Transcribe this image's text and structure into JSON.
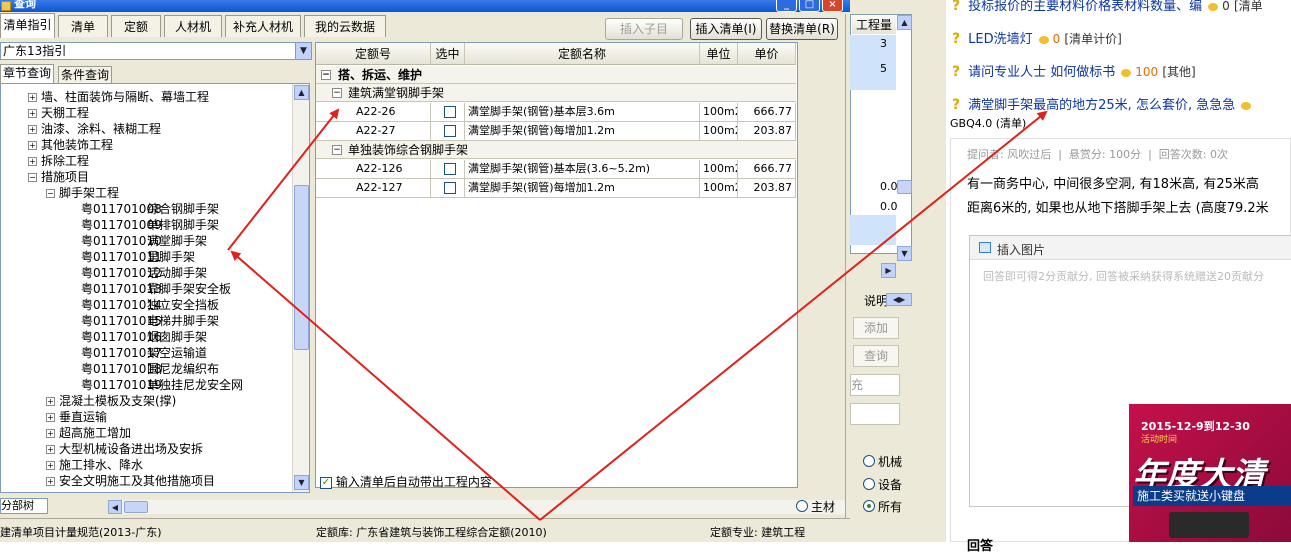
{
  "window": {
    "title": "查询"
  },
  "tabs": [
    "清单指引",
    "清单",
    "定额",
    "人材机",
    "补充人材机",
    "我的云数据"
  ],
  "buttons": {
    "insert_child": "插入子目",
    "insert_list": "插入清单(I)",
    "replace_list": "替换清单(R)"
  },
  "combo": {
    "value": "广东13指引"
  },
  "subtabs": [
    "章节查询",
    "条件查询"
  ],
  "tree": [
    {
      "label": "墙、柱面装饰与隔断、幕墙工程",
      "sign": "+"
    },
    {
      "label": "天棚工程",
      "sign": "+"
    },
    {
      "label": "油漆、涂料、裱糊工程",
      "sign": "+"
    },
    {
      "label": "其他装饰工程",
      "sign": "+"
    },
    {
      "label": "拆除工程",
      "sign": "+"
    },
    {
      "label": "措施项目",
      "sign": "−"
    },
    {
      "label": "脚手架工程",
      "sign": "−"
    }
  ],
  "leaves": [
    {
      "code": "粤011701008",
      "name": "综合钢脚手架"
    },
    {
      "code": "粤011701009",
      "name": "单排钢脚手架"
    },
    {
      "code": "粤011701010",
      "name": "满堂脚手架"
    },
    {
      "code": "粤011701011",
      "name": "里脚手架"
    },
    {
      "code": "粤011701012",
      "name": "活动脚手架"
    },
    {
      "code": "粤011701013",
      "name": "靠脚手架安全板"
    },
    {
      "code": "粤011701014",
      "name": "独立安全挡板"
    },
    {
      "code": "粤011701015",
      "name": "电梯井脚手架"
    },
    {
      "code": "粤011701016",
      "name": "烟囱脚手架"
    },
    {
      "code": "粤011701017",
      "name": "架空运输道"
    },
    {
      "code": "粤011701018",
      "name": "围尼龙编织布"
    },
    {
      "code": "粤011701019",
      "name": "单独挂尼龙安全网"
    }
  ],
  "tree_after": [
    {
      "label": "混凝土模板及支架(撑)",
      "sign": "+"
    },
    {
      "label": "垂直运输",
      "sign": "+"
    },
    {
      "label": "超高施工增加",
      "sign": "+"
    },
    {
      "label": "大型机械设备进出场及安拆",
      "sign": "+"
    },
    {
      "label": "施工排水、降水",
      "sign": "+"
    },
    {
      "label": "安全文明施工及其他措施项目",
      "sign": "+"
    }
  ],
  "bottom_tab": "分部树",
  "grid": {
    "headers": [
      "定额号",
      "选中",
      "定额名称",
      "单位",
      "单价"
    ],
    "group": "搭、拆运、维护",
    "subgroups": [
      {
        "title": "建筑满堂钢脚手架",
        "rows": [
          {
            "code": "A22-26",
            "name": "满堂脚手架(钢管)基本层3.6m",
            "unit": "100m2",
            "price": "666.77"
          },
          {
            "code": "A22-27",
            "name": "满堂脚手架(钢管)每增加1.2m",
            "unit": "100m2",
            "price": "203.87"
          }
        ]
      },
      {
        "title": "单独装饰综合钢脚手架",
        "rows": [
          {
            "code": "A22-126",
            "name": "满堂脚手架(钢管)基本层(3.6~5.2m)",
            "unit": "100m2",
            "price": "666.77"
          },
          {
            "code": "A22-127",
            "name": "满堂脚手架(钢管)每增加1.2m",
            "unit": "100m2",
            "price": "203.87"
          }
        ]
      }
    ]
  },
  "auto_check": "输入清单后自动带出工程内容",
  "status": {
    "left": "建清单项目计量规范(2013-广东)",
    "mid": "定额库: 广东省建筑与装饰工程综合定额(2010)",
    "right": "定额专业: 建筑工程"
  },
  "behind": {
    "col_header": "工程量",
    "val1": "3",
    "val2": "5",
    "val3": "0.0",
    "val4": "0.0",
    "desc_label": "说明",
    "add": "添加",
    "query": "查询",
    "supplement": "充",
    "radios": [
      "机械",
      "设备",
      "主材",
      "所有"
    ]
  },
  "web": {
    "q1": {
      "text": "投标报价的主要材料价格表材料数量、编",
      "coin": "0",
      "cat": "[清单"
    },
    "q2": {
      "text": "LED洗墙灯",
      "coin": "0",
      "cat": "[清单计价]"
    },
    "q3": {
      "text": "请问专业人士 如何做标书",
      "coin": "100",
      "cat": "[其他]"
    },
    "q4": {
      "text": "满堂脚手架最高的地方25米, 怎么套价, 急急急",
      "coin": "",
      "cat": "GBQ4.0 (清单)"
    },
    "meta": "提问者: 风吹过后  |  悬赏分: 100分  |  回答次数: 0次",
    "body1": "有一商务中心, 中间很多空洞, 有18米高, 有25米高",
    "body2": "距离6米的, 如果也从地下搭脚手架上去 (高度79.2米",
    "insert_img": "插入图片",
    "placeholder": "回答即可得2分贡献分, 回答被采纳获得系统赠送20贡献分",
    "ad_date": "2015-12-9到12-30",
    "ad_sub": "活动时间",
    "ad_title": "年度大清",
    "ad_slogan": "施工类买就送小键盘",
    "answer": "回答"
  },
  "colors": {
    "accent": "#0b36a3",
    "arrow": "#e0201a"
  }
}
